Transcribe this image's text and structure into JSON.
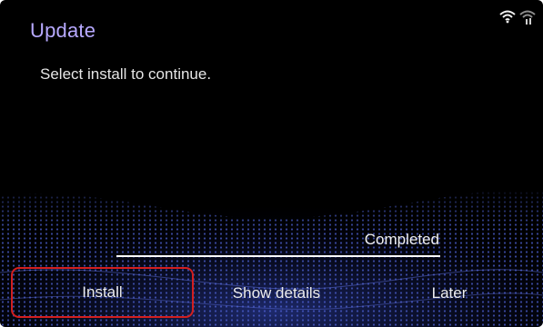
{
  "header": {
    "title": "Update",
    "wifi_icon": "wifi-icon",
    "signal_icon": "cellular-signal-icon"
  },
  "main": {
    "message": "Select install to continue."
  },
  "progress": {
    "label": "Completed",
    "fraction": 1.0
  },
  "buttons": {
    "install": "Install",
    "details": "Show details",
    "later": "Later"
  },
  "colors": {
    "title": "#b7a9ff",
    "highlight_border": "#d21f1f",
    "wave": "#3a4aa8"
  }
}
